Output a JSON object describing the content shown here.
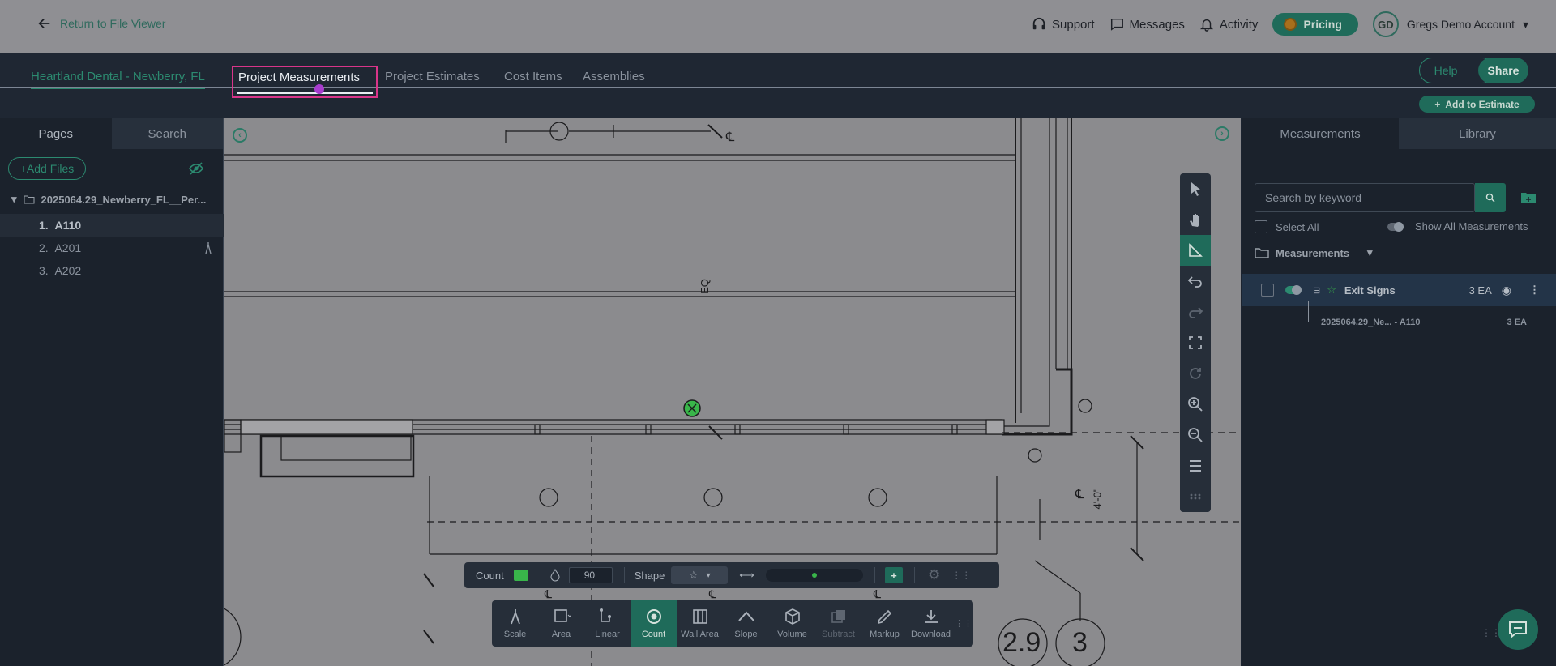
{
  "topbar": {
    "back_label": "Return to File Viewer",
    "support": "Support",
    "messages": "Messages",
    "activity": "Activity",
    "pricing": "Pricing",
    "avatar_initials": "GD",
    "account_name": "Gregs Demo Account"
  },
  "tabs": {
    "project_name": "Heartland Dental - Newberry, FL",
    "items": [
      "Project Measurements",
      "Project Estimates",
      "Cost Items",
      "Assemblies"
    ],
    "help": "Help",
    "share": "Share",
    "add_to_estimate": "Add to Estimate"
  },
  "left_panel": {
    "tabs": [
      "Pages",
      "Search"
    ],
    "add_files": "+Add Files",
    "folder": "2025064.29_Newberry_FL__Per...",
    "pages": [
      {
        "num": "1.",
        "name": "A110"
      },
      {
        "num": "2.",
        "name": "A201"
      },
      {
        "num": "3.",
        "name": "A202"
      }
    ]
  },
  "canvas": {
    "labels": [
      "EQ",
      "4'-0\"",
      "2.9",
      "3"
    ]
  },
  "count_bar": {
    "label": "Count",
    "color": "#39b54a",
    "opacity": "90",
    "shape_label": "Shape"
  },
  "tools": [
    "Scale",
    "Area",
    "Linear",
    "Count",
    "Wall Area",
    "Slope",
    "Volume",
    "Subtract",
    "Markup",
    "Download"
  ],
  "right_panel": {
    "tabs": [
      "Measurements",
      "Library"
    ],
    "search_placeholder": "Search by keyword",
    "select_all": "Select All",
    "show_all": "Show All Measurements",
    "folder": "Measurements",
    "measurement": {
      "name": "Exit Signs",
      "qty": "3 EA"
    },
    "sub_item": {
      "name": "2025064.29_Ne... - A110",
      "qty": "3 EA"
    }
  },
  "colors": {
    "accent": "#1f6b5a",
    "highlight": "#d9358a"
  }
}
